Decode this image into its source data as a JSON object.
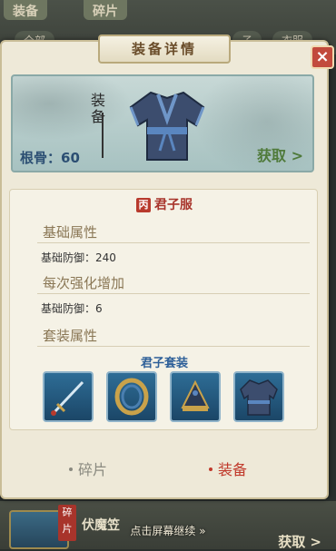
{
  "background": {
    "tabs": [
      "装备",
      "碎片"
    ],
    "filters": [
      "全部",
      "子",
      "衣服"
    ],
    "bottom_item": {
      "badge": "碎片",
      "name": "伏魔笠",
      "get_label": "获取 >"
    }
  },
  "dialog": {
    "title": "装备详情",
    "close_label": "×",
    "hero": {
      "calligraphy": "装备",
      "stat_label": "根骨：",
      "stat_value": "60",
      "get_label": "获取 >"
    },
    "item": {
      "grade": "丙",
      "name": "君子服"
    },
    "sections": {
      "base_title": "基础属性",
      "base_stat_label": "基础防御：",
      "base_stat_value": "240",
      "enhance_title": "每次强化增加",
      "enhance_stat_label": "基础防御：",
      "enhance_stat_value": "6",
      "set_title": "套装属性",
      "set_name": "君子套装"
    },
    "set_items": [
      {
        "icon": "sword-icon"
      },
      {
        "icon": "ring-icon"
      },
      {
        "icon": "crown-icon"
      },
      {
        "icon": "robe-icon"
      }
    ],
    "tabs": {
      "fragments": "碎片",
      "equipment": "装备"
    },
    "colors": {
      "active_tab": "#c0392b",
      "inactive_tab": "#8a8a80",
      "set_name": "#2d5f98",
      "item_name": "#a8342b"
    }
  },
  "continue_hint": "点击屏幕继续  »"
}
